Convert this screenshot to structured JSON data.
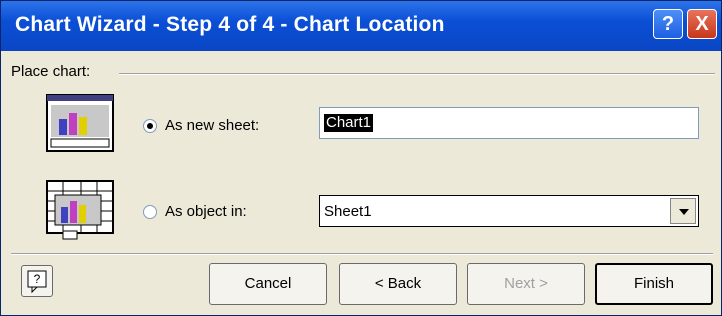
{
  "window": {
    "title": "Chart Wizard - Step 4 of 4 - Chart Location"
  },
  "titlebar_buttons": {
    "help": "?",
    "close": "X"
  },
  "group": {
    "label": "Place chart:"
  },
  "options": [
    {
      "label": "As new sheet:",
      "selected": true,
      "value": "Chart1"
    },
    {
      "label": "As object in:",
      "selected": false,
      "value": "Sheet1"
    }
  ],
  "buttons": {
    "cancel": "Cancel",
    "back": "< Back",
    "next": "Next >",
    "finish": "Finish"
  },
  "icons": [
    "new-sheet-chart-icon",
    "embedded-chart-icon",
    "office-assistant-help-icon",
    "dropdown-arrow-icon"
  ],
  "colors": {
    "titlebar": "#0b4fd6",
    "dialog": "#ece9d8",
    "close": "#c7361b"
  }
}
